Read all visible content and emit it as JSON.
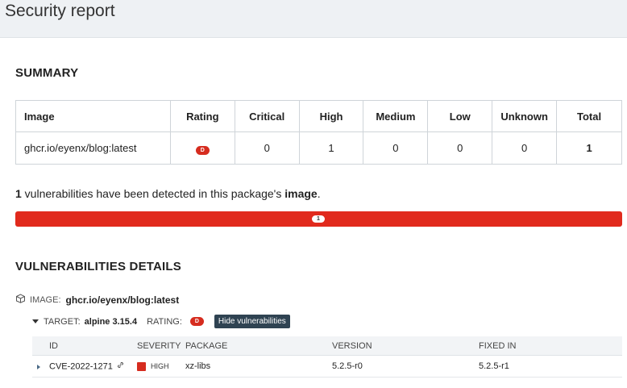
{
  "header": {
    "title": "Security report"
  },
  "summary": {
    "title": "SUMMARY",
    "columns": [
      "Image",
      "Rating",
      "Critical",
      "High",
      "Medium",
      "Low",
      "Unknown",
      "Total"
    ],
    "row": {
      "image": "ghcr.io/eyenx/blog:latest",
      "rating": "D",
      "critical": "0",
      "high": "1",
      "medium": "0",
      "low": "0",
      "unknown": "0",
      "total": "1"
    }
  },
  "detection": {
    "count": "1",
    "text_middle": " vulnerabilities have been detected in this package's ",
    "text_bold": "image",
    "text_end": ".",
    "bar_count": "1",
    "bar_color": "#e12a1d"
  },
  "details": {
    "title": "VULNERABILITIES DETAILS",
    "image_label": "IMAGE:",
    "image_value": "ghcr.io/eyenx/blog:latest",
    "target_label": "TARGET:",
    "target_value": "alpine 3.15.4",
    "rating_label": "RATING:",
    "rating_value": "D",
    "hide_button": "Hide vulnerabilities",
    "columns": {
      "id": "ID",
      "severity": "SEVERITY",
      "package": "PACKAGE",
      "version": "VERSION",
      "fixed_in": "FIXED IN"
    },
    "rows": [
      {
        "id": "CVE-2022-1271",
        "severity": "HIGH",
        "package": "xz-libs",
        "version": "5.2.5-r0",
        "fixed_in": "5.2.5-r1"
      }
    ]
  },
  "colors": {
    "critical_red": "#d62c1f",
    "badge_dark": "#2f4352"
  },
  "icons": [
    "package-icon",
    "caret-down-icon",
    "caret-right-icon",
    "link-icon"
  ]
}
